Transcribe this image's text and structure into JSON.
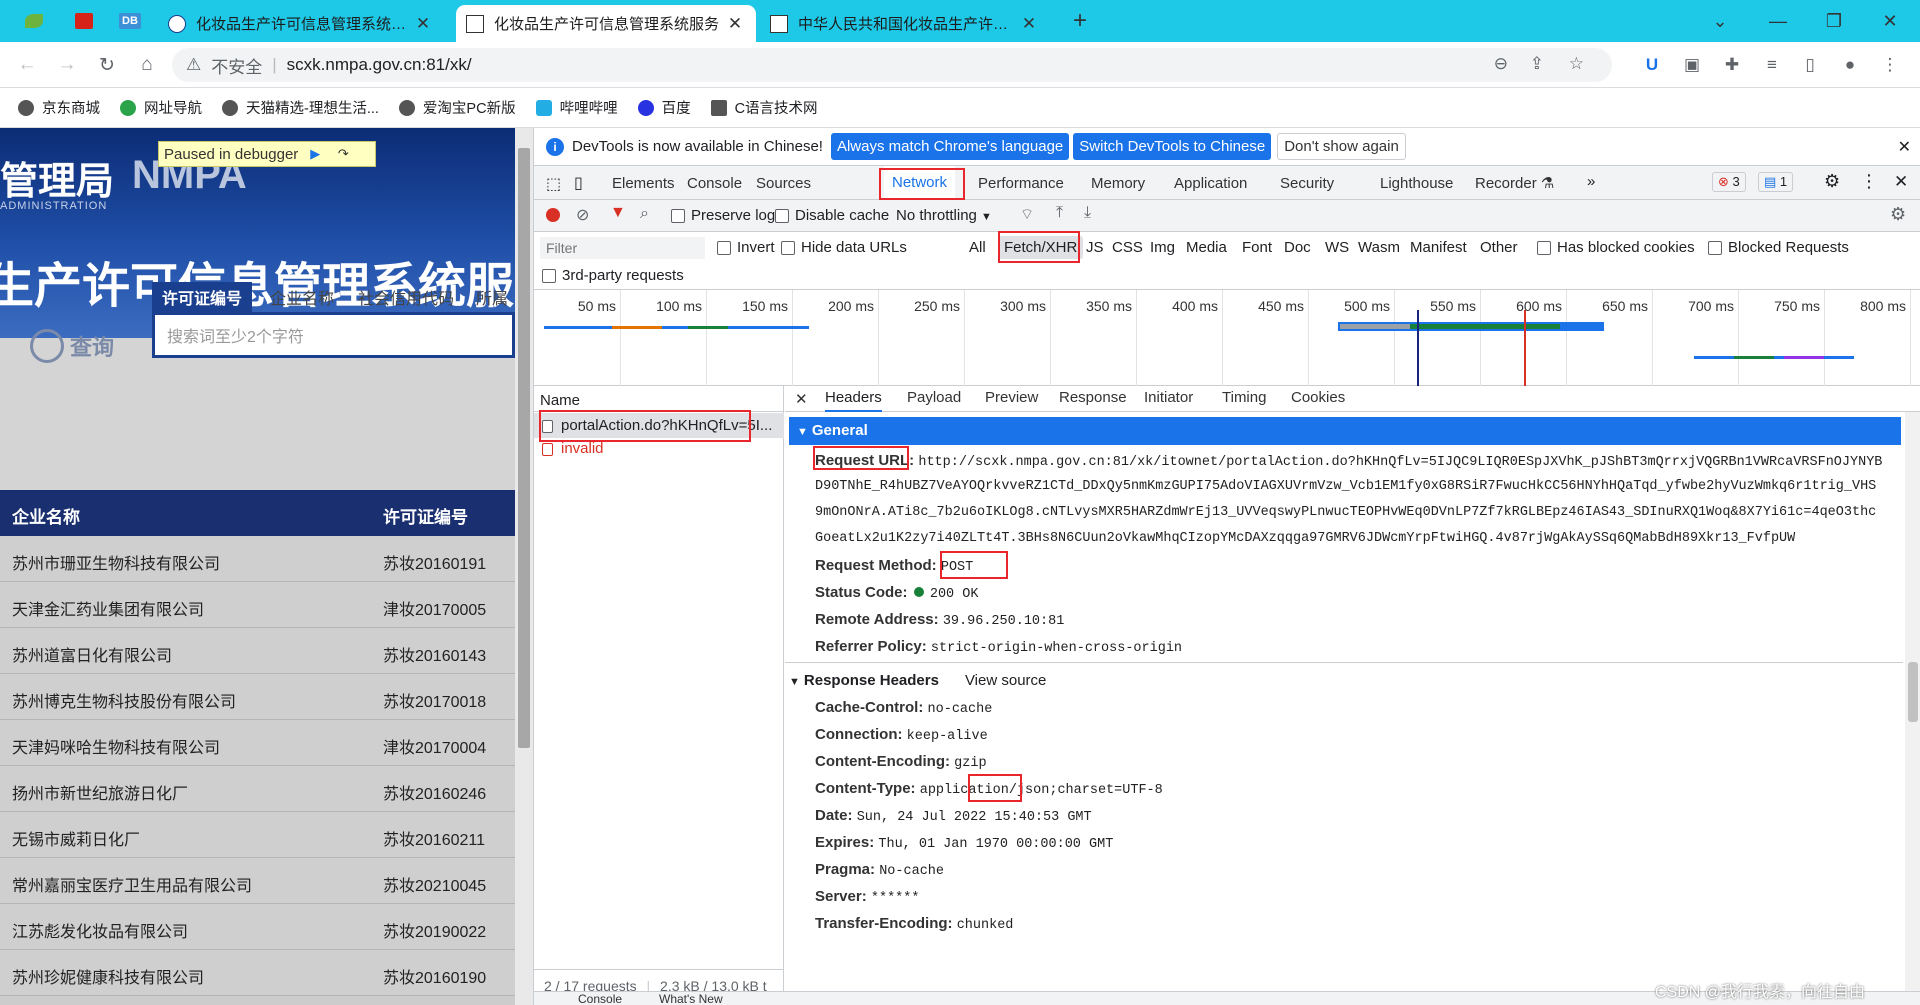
{
  "tabs": [
    {
      "title": "化妆品生产许可信息管理系统服务",
      "active": false
    },
    {
      "title": "化妆品生产许可信息管理系统服务",
      "active": true
    },
    {
      "title": "中华人民共和国化妆品生产许可证",
      "active": false
    }
  ],
  "pinned": [
    "DB"
  ],
  "address": {
    "security": "不安全",
    "url": "scxk.nmpa.gov.cn:81/xk/"
  },
  "bookmarks": [
    "京东商城",
    "网址导航",
    "天猫精选-理想生活...",
    "爱淘宝PC新版",
    "哔哩哔哩",
    "百度",
    "C语言技术网"
  ],
  "page": {
    "banner_title_1": "管理局",
    "banner_title_2": "NMPA",
    "banner_sub": "ADMINISTRATION",
    "banner_title_3": "生产许可信息管理系统服",
    "paused": "Paused in debugger",
    "search_tabs": [
      "许可证编号",
      "企业名称",
      "社会信用代码",
      "所属"
    ],
    "query_label": "查询",
    "search_placeholder": "搜索词至少2个字符",
    "table_headers": [
      "企业名称",
      "许可证编号"
    ],
    "rows": [
      [
        "苏州市珊亚生物科技有限公司",
        "苏妆20160191"
      ],
      [
        "天津金汇药业集团有限公司",
        "津妆20170005"
      ],
      [
        "苏州道富日化有限公司",
        "苏妆20160143"
      ],
      [
        "苏州博克生物科技股份有限公司",
        "苏妆20170018"
      ],
      [
        "天津妈咪哈生物科技有限公司",
        "津妆20170004"
      ],
      [
        "扬州市新世纪旅游日化厂",
        "苏妆20160246"
      ],
      [
        "无锡市威莉日化厂",
        "苏妆20160211"
      ],
      [
        "常州嘉丽宝医疗卫生用品有限公司",
        "苏妆20210045"
      ],
      [
        "江苏彪发化妆品有限公司",
        "苏妆20190022"
      ],
      [
        "苏州珍妮健康科技有限公司",
        "苏妆20160190"
      ]
    ]
  },
  "devtools": {
    "info": "DevTools is now available in Chinese!",
    "btn_match": "Always match Chrome's language",
    "btn_switch": "Switch DevTools to Chinese",
    "btn_dont": "Don't show again",
    "panels": [
      "Elements",
      "Console",
      "Sources",
      "Network",
      "Performance",
      "Memory",
      "Application",
      "Security",
      "Lighthouse",
      "Recorder"
    ],
    "errors": "3",
    "messages": "1",
    "preserve_log": "Preserve log",
    "disable_cache": "Disable cache",
    "throttling": "No throttling",
    "filter_placeholder": "Filter",
    "invert": "Invert",
    "hide_data_urls": "Hide data URLs",
    "types": [
      "All",
      "Fetch/XHR",
      "JS",
      "CSS",
      "Img",
      "Media",
      "Font",
      "Doc",
      "WS",
      "Wasm",
      "Manifest",
      "Other"
    ],
    "has_blocked": "Has blocked cookies",
    "blocked_requests": "Blocked Requests",
    "third_party": "3rd-party requests",
    "timeline_labels": [
      "50 ms",
      "100 ms",
      "150 ms",
      "200 ms",
      "250 ms",
      "300 ms",
      "350 ms",
      "400 ms",
      "450 ms",
      "500 ms",
      "550 ms",
      "600 ms",
      "650 ms",
      "700 ms",
      "750 ms",
      "800 ms"
    ],
    "name_header": "Name",
    "requests": [
      {
        "name": "portalAction.do?hKHnQfLv=5I...",
        "color": "#202124"
      },
      {
        "name": "invalid",
        "color": "#d93025"
      }
    ],
    "footer_requests": "2 / 17 requests",
    "footer_size": "2.3 kB / 13.0 kB t",
    "detail_tabs": [
      "Headers",
      "Payload",
      "Preview",
      "Response",
      "Initiator",
      "Timing",
      "Cookies"
    ],
    "general_label": "General",
    "request_url_label": "Request URL:",
    "request_url_lines": [
      "http://scxk.nmpa.gov.cn:81/xk/itownet/portalAction.do?hKHnQfLv=5IJQC9LIQR0ESpJXVhK_pJShBT3mQrrxjVQGRBn1VWRcaVRSFnOJYNYB",
      "D90TNhE_R4hUBZ7VeAYOQrkvveRZ1CTd_DDxQy5nmKmzGUPI75AdoVIAGXUVrmVzw_Vcb1EM1fy0xG8RSiR7FwucHkCC56HNYhHQaTqd_yfwbe2hyVuzWmkq6r1trig_VHS",
      "9mOnONrA.ATi8c_7b2u6oIKLOg8.cNTLvysMXR5HARZdmWrEj13_UVVeqswyPLnwucTEOPHvWEq0DVnLP7Zf7kRGLBEpz46IAS43_SDInuRXQ1Woq&8X7Yi61c=4qeO3thc",
      "GoeatLx2u1K2zy7i40ZLTt4T.3BHs8N6CUun2oVkawMhqCIzopYMcDAXzqqga97GMRV6JDWcmYrpFtwiHGQ.4v87rjWgAkAySSq6QMabBdH89Xkr13_FvfpUW"
    ],
    "request_method_label": "Request Method:",
    "request_method": "POST",
    "status_label": "Status Code:",
    "status": "200 OK",
    "remote_label": "Remote Address:",
    "remote": "39.96.250.10:81",
    "referrer_label": "Referrer Policy:",
    "referrer": "strict-origin-when-cross-origin",
    "response_headers_label": "Response Headers",
    "view_source": "View source",
    "response_headers": [
      {
        "k": "Cache-Control:",
        "v": "no-cache"
      },
      {
        "k": "Connection:",
        "v": "keep-alive"
      },
      {
        "k": "Content-Encoding:",
        "v": "gzip"
      },
      {
        "k": "Content-Type:",
        "v": "application/json;charset=UTF-8"
      },
      {
        "k": "Date:",
        "v": "Sun, 24 Jul 2022 15:40:53 GMT"
      },
      {
        "k": "Expires:",
        "v": "Thu, 01 Jan 1970 00:00:00 GMT"
      },
      {
        "k": "Pragma:",
        "v": "No-cache"
      },
      {
        "k": "Server:",
        "v": "******"
      },
      {
        "k": "Transfer-Encoding:",
        "v": "chunked"
      }
    ],
    "drawer": [
      "Console",
      "What's New"
    ]
  },
  "watermark": "CSDN @我行我素，向往自由"
}
